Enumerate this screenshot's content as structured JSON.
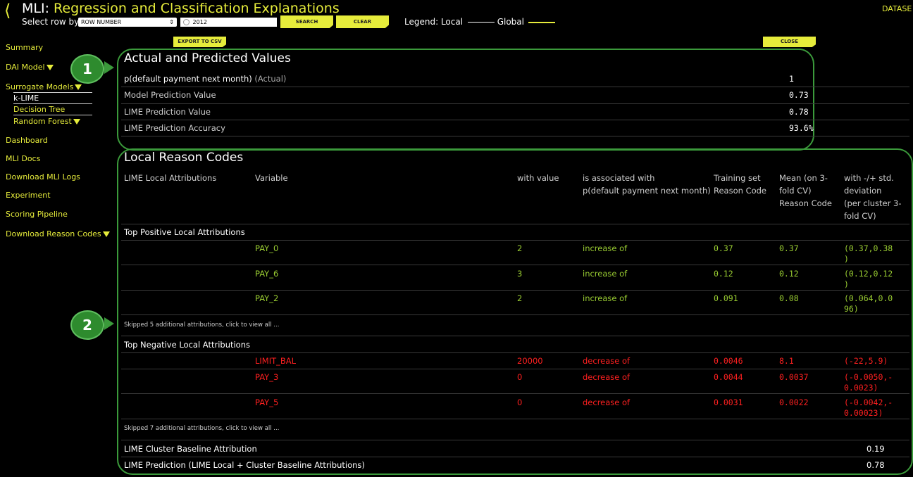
{
  "header": {
    "back_icon": "chevron-left-icon",
    "title_prefix": "MLI:",
    "title_rest": "Regression and Classification Explanations",
    "select_row_label": "Select row by:",
    "select_value": "ROW NUMBER",
    "search_value": "2012",
    "search_button": "SEARCH",
    "clear_button": "CLEAR",
    "legend_label": "Legend: Local",
    "legend_global": "Global",
    "dataset_link": "DATASE"
  },
  "toolbar": {
    "export_button": "EXPORT TO CSV",
    "close_button": "CLOSE"
  },
  "sidebar": {
    "items": [
      {
        "label": "Summary"
      },
      {
        "label": "DAI Model"
      },
      {
        "label": "Surrogate Models"
      },
      {
        "label": "k-LIME"
      },
      {
        "label": "Decision Tree"
      },
      {
        "label": "Random Forest"
      },
      {
        "label": "Dashboard"
      },
      {
        "label": "MLI Docs"
      },
      {
        "label": "Download MLI Logs"
      },
      {
        "label": "Experiment"
      },
      {
        "label": "Scoring Pipeline"
      },
      {
        "label": "Download Reason Codes"
      }
    ]
  },
  "annotations": {
    "badge1": "1",
    "badge2": "2"
  },
  "actual_predicted": {
    "title": "Actual and Predicted Values",
    "rows": [
      {
        "label": "p(default payment next month)",
        "suffix": "(Actual)",
        "value": "1"
      },
      {
        "label": "Model Prediction Value",
        "suffix": "",
        "value": "0.73"
      },
      {
        "label": "LIME Prediction Value",
        "suffix": "",
        "value": "0.78"
      },
      {
        "label": "LIME Prediction Accuracy",
        "suffix": "",
        "value": "93.6%"
      }
    ]
  },
  "reason_codes": {
    "title": "Local Reason Codes",
    "columns": {
      "c1": "LIME Local Attributions",
      "c2": "Variable",
      "c3": "with value",
      "c4a": "is associated with",
      "c4b": "p(default payment next month)",
      "c5a": "Training set",
      "c5b": "Reason Code",
      "c6a": "Mean (on 3-",
      "c6b": "fold CV)",
      "c6c": "Reason Code",
      "c7a": "with -/+ std.",
      "c7b": "deviation",
      "c7c": "(per cluster 3-",
      "c7d": "fold CV)"
    },
    "positive_header": "Top Positive Local Attributions",
    "positive": [
      {
        "var": "PAY_0",
        "val": "2",
        "assoc": "increase of",
        "train": "0.37",
        "mean": "0.37",
        "dev1": "(0.37,0.38",
        "dev2": ")"
      },
      {
        "var": "PAY_6",
        "val": "3",
        "assoc": "increase of",
        "train": "0.12",
        "mean": "0.12",
        "dev1": "(0.12,0.12",
        "dev2": ")"
      },
      {
        "var": "PAY_2",
        "val": "2",
        "assoc": "increase of",
        "train": "0.091",
        "mean": "0.08",
        "dev1": "(0.064,0.0",
        "dev2": "96)"
      }
    ],
    "skipped_positive": "Skipped 5 additional attributions, click to view all ...",
    "negative_header": "Top Negative Local Attributions",
    "negative": [
      {
        "var": "LIMIT_BAL",
        "val": "20000",
        "assoc": "decrease of",
        "train": "0.0046",
        "mean": "8.1",
        "dev1": "(-22,5.9)",
        "dev2": ""
      },
      {
        "var": "PAY_3",
        "val": "0",
        "assoc": "decrease of",
        "train": "0.0044",
        "mean": "0.0037",
        "dev1": "(-0.0050,-",
        "dev2": "0.0023)"
      },
      {
        "var": "PAY_5",
        "val": "0",
        "assoc": "decrease of",
        "train": "0.0031",
        "mean": "0.0022",
        "dev1": "(-0.0042,-",
        "dev2": "0.00023)"
      }
    ],
    "skipped_negative": "Skipped 7 additional attributions, click to view all ...",
    "baseline_label": "LIME Cluster Baseline Attribution",
    "baseline_value": "0.19",
    "prediction_label": "LIME Prediction (LIME Local + Cluster Baseline Attributions)",
    "prediction_value": "0.78"
  }
}
